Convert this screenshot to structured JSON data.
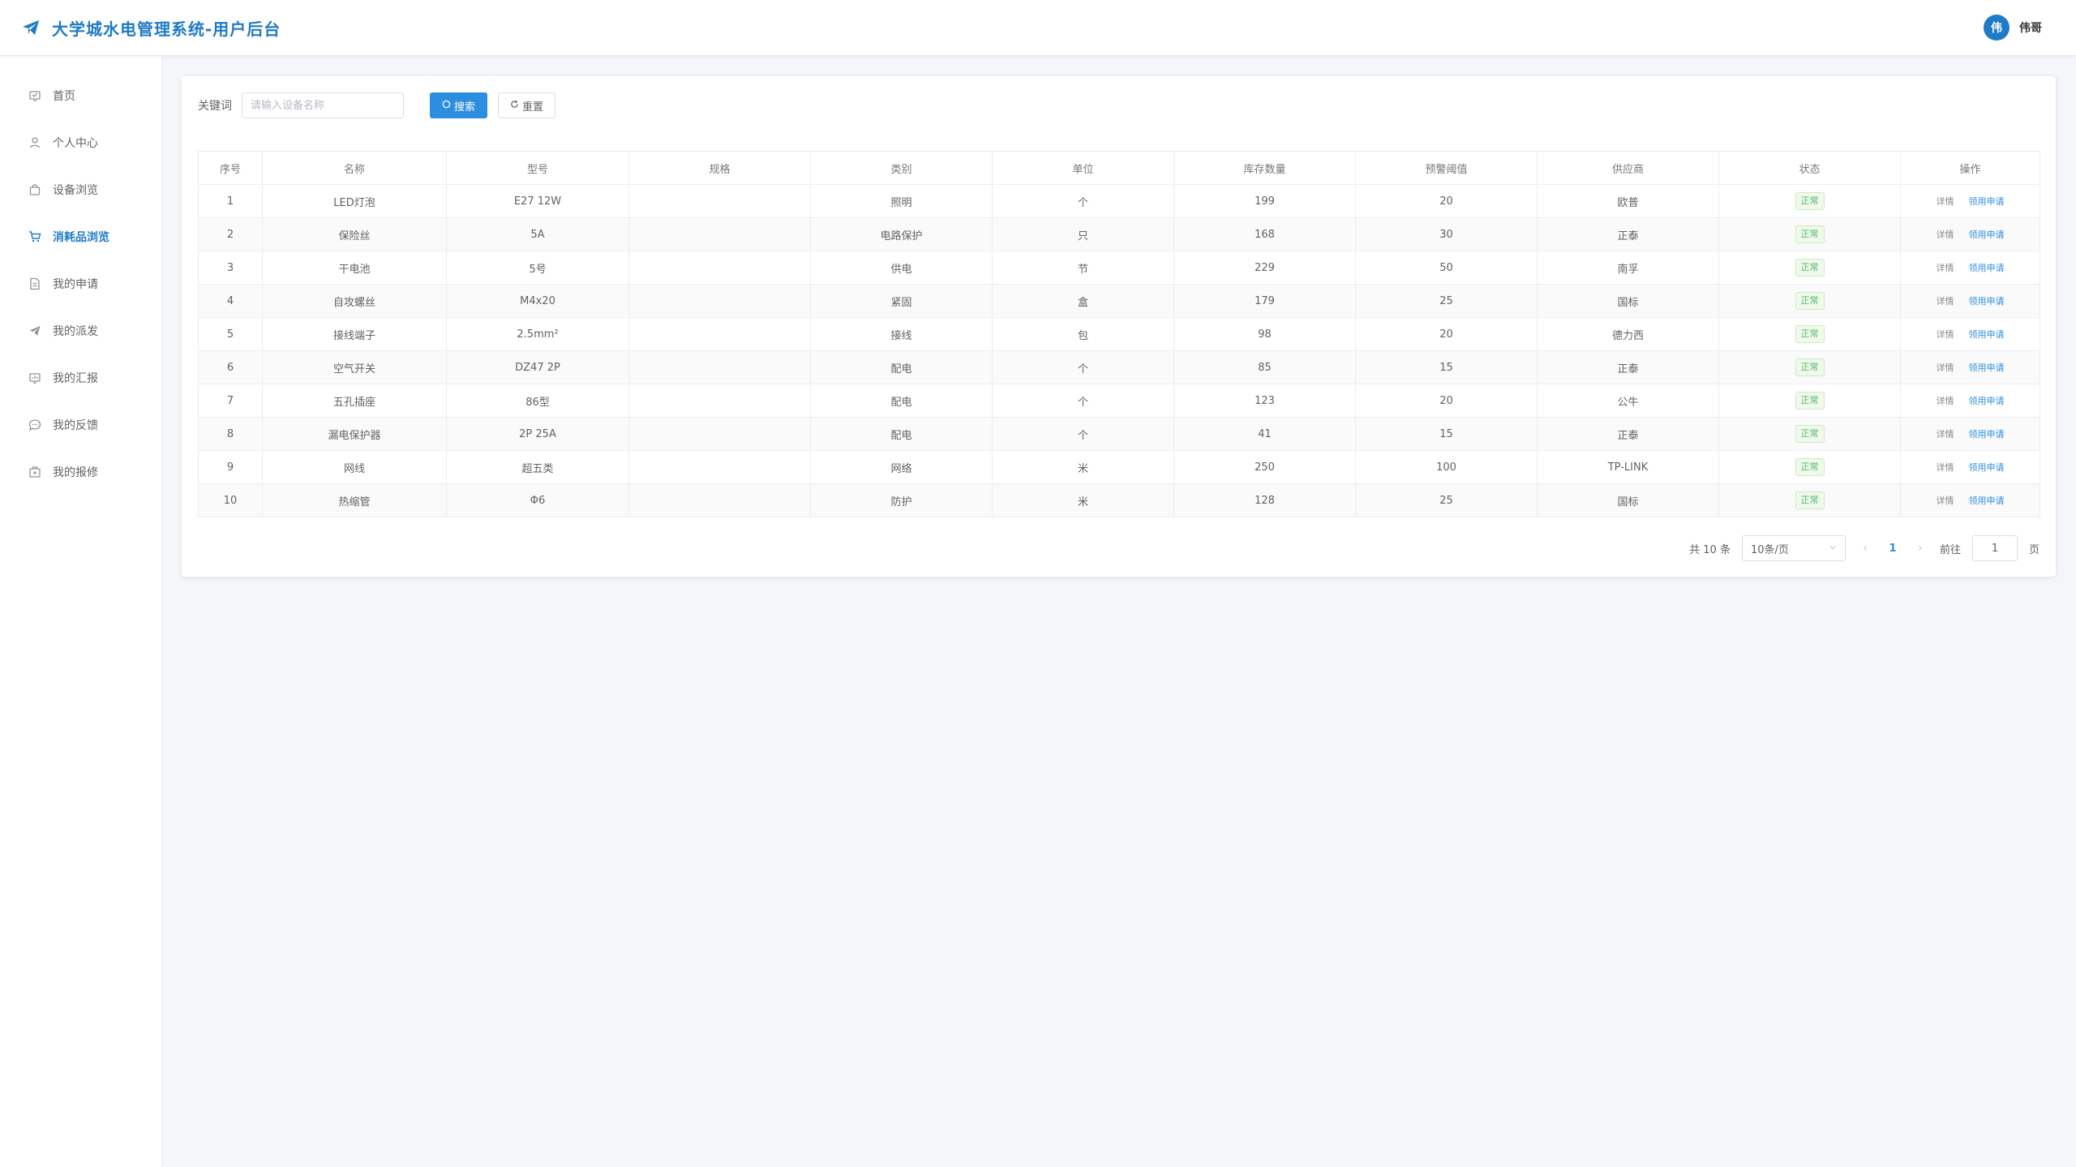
{
  "header": {
    "title": "大学城水电管理系统-用户后台",
    "avatar_char": "伟",
    "username": "伟哥",
    "accent": "#1f7bc7"
  },
  "sidebar": {
    "items": [
      {
        "label": "首页",
        "icon": "home-icon"
      },
      {
        "label": "个人中心",
        "icon": "user-icon"
      },
      {
        "label": "设备浏览",
        "icon": "bag-icon"
      },
      {
        "label": "消耗品浏览",
        "icon": "cart-icon",
        "active": true
      },
      {
        "label": "我的申请",
        "icon": "document-icon"
      },
      {
        "label": "我的派发",
        "icon": "send-icon"
      },
      {
        "label": "我的汇报",
        "icon": "report-icon"
      },
      {
        "label": "我的反馈",
        "icon": "chat-icon"
      },
      {
        "label": "我的报修",
        "icon": "repair-icon"
      }
    ]
  },
  "search": {
    "label": "关键词",
    "placeholder": "请输入设备名称",
    "value": "",
    "search_button": "搜索",
    "reset_button": "重置"
  },
  "table": {
    "headers": [
      "序号",
      "名称",
      "型号",
      "规格",
      "类别",
      "单位",
      "库存数量",
      "预警阈值",
      "供应商",
      "状态",
      "操作"
    ],
    "rows": [
      {
        "no": "1",
        "name": "LED灯泡",
        "model": "E27 12W",
        "spec": "",
        "category": "照明",
        "unit": "个",
        "stock": "199",
        "threshold": "20",
        "supplier": "欧普",
        "status": "正常"
      },
      {
        "no": "2",
        "name": "保险丝",
        "model": "5A",
        "spec": "",
        "category": "电路保护",
        "unit": "只",
        "stock": "168",
        "threshold": "30",
        "supplier": "正泰",
        "status": "正常"
      },
      {
        "no": "3",
        "name": "干电池",
        "model": "5号",
        "spec": "",
        "category": "供电",
        "unit": "节",
        "stock": "229",
        "threshold": "50",
        "supplier": "南孚",
        "status": "正常"
      },
      {
        "no": "4",
        "name": "自攻螺丝",
        "model": "M4x20",
        "spec": "",
        "category": "紧固",
        "unit": "盒",
        "stock": "179",
        "threshold": "25",
        "supplier": "国标",
        "status": "正常"
      },
      {
        "no": "5",
        "name": "接线端子",
        "model": "2.5mm²",
        "spec": "",
        "category": "接线",
        "unit": "包",
        "stock": "98",
        "threshold": "20",
        "supplier": "德力西",
        "status": "正常"
      },
      {
        "no": "6",
        "name": "空气开关",
        "model": "DZ47 2P",
        "spec": "",
        "category": "配电",
        "unit": "个",
        "stock": "85",
        "threshold": "15",
        "supplier": "正泰",
        "status": "正常"
      },
      {
        "no": "7",
        "name": "五孔插座",
        "model": "86型",
        "spec": "",
        "category": "配电",
        "unit": "个",
        "stock": "123",
        "threshold": "20",
        "supplier": "公牛",
        "status": "正常"
      },
      {
        "no": "8",
        "name": "漏电保护器",
        "model": "2P 25A",
        "spec": "",
        "category": "配电",
        "unit": "个",
        "stock": "41",
        "threshold": "15",
        "supplier": "正泰",
        "status": "正常"
      },
      {
        "no": "9",
        "name": "网线",
        "model": "超五类",
        "spec": "",
        "category": "网络",
        "unit": "米",
        "stock": "250",
        "threshold": "100",
        "supplier": "TP-LINK",
        "status": "正常"
      },
      {
        "no": "10",
        "name": "热缩管",
        "model": "Φ6",
        "spec": "",
        "category": "防护",
        "unit": "米",
        "stock": "128",
        "threshold": "25",
        "supplier": "国标",
        "status": "正常"
      }
    ],
    "detail_label": "详情",
    "apply_label": "领用申请"
  },
  "pagination": {
    "total_text": "共 10 条",
    "page_size": "10条/页",
    "current_page": "1",
    "goto_label": "前往",
    "goto_value": "1",
    "page_suffix": "页"
  }
}
